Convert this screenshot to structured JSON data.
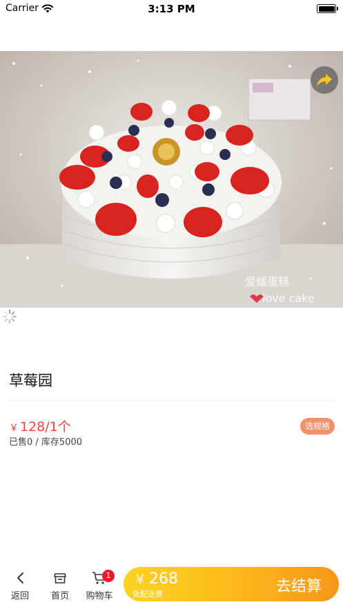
{
  "status": {
    "carrier": "Carrier",
    "time": "3:13 PM",
    "battery_level": 1.0
  },
  "product": {
    "image_watermark_cn": "爱耀蛋糕",
    "image_watermark_en": "love cake",
    "title": "草莓园",
    "price_currency": "￥",
    "price": "128/1个",
    "sales": "已售0 / 库存5000",
    "spec_button": "选规格"
  },
  "icons": {
    "share": "share-arrow-icon",
    "back": "chevron-left-icon",
    "home": "store-icon",
    "cart": "cart-icon",
    "loading": "spinner-icon"
  },
  "bottom_bar": {
    "back_label": "返回",
    "home_label": "首页",
    "cart_label": "购物车",
    "cart_badge": "1",
    "total_currency": "￥",
    "total": "268",
    "free_delivery": "免配送费",
    "checkout_label": "去结算"
  },
  "colors": {
    "accent_red": "#f0453a",
    "spec_button": "#f4916b",
    "checkout_start": "#fdd323",
    "checkout_end": "#f7961a",
    "badge": "#f0192c"
  }
}
